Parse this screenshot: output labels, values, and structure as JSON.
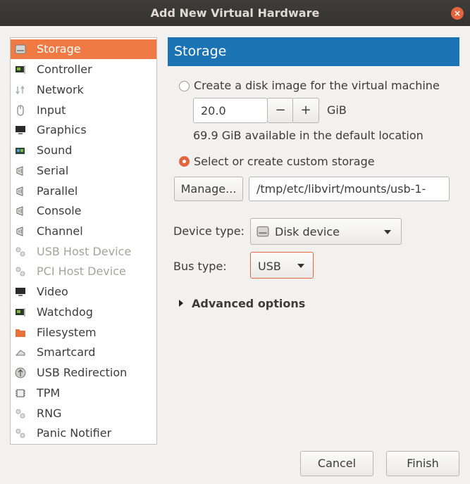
{
  "window": {
    "title": "Add New Virtual Hardware",
    "close_symbol": "×"
  },
  "sidebar": {
    "selected_index": 0,
    "items": [
      {
        "label": "Storage",
        "icon": "disk-icon",
        "enabled": true
      },
      {
        "label": "Controller",
        "icon": "chip-icon",
        "enabled": true
      },
      {
        "label": "Network",
        "icon": "network-icon",
        "enabled": true
      },
      {
        "label": "Input",
        "icon": "mouse-icon",
        "enabled": true
      },
      {
        "label": "Graphics",
        "icon": "monitor-icon",
        "enabled": true
      },
      {
        "label": "Sound",
        "icon": "sound-card-icon",
        "enabled": true
      },
      {
        "label": "Serial",
        "icon": "port-icon",
        "enabled": true
      },
      {
        "label": "Parallel",
        "icon": "port-icon",
        "enabled": true
      },
      {
        "label": "Console",
        "icon": "port-icon",
        "enabled": true
      },
      {
        "label": "Channel",
        "icon": "port-icon",
        "enabled": true
      },
      {
        "label": "USB Host Device",
        "icon": "device-icon",
        "enabled": false
      },
      {
        "label": "PCI Host Device",
        "icon": "device-icon",
        "enabled": false
      },
      {
        "label": "Video",
        "icon": "monitor-icon",
        "enabled": true
      },
      {
        "label": "Watchdog",
        "icon": "chip-icon",
        "enabled": true
      },
      {
        "label": "Filesystem",
        "icon": "folder-icon",
        "enabled": true
      },
      {
        "label": "Smartcard",
        "icon": "smartcard-icon",
        "enabled": true
      },
      {
        "label": "USB Redirection",
        "icon": "usb-icon",
        "enabled": true
      },
      {
        "label": "TPM",
        "icon": "tpm-chip-icon",
        "enabled": true
      },
      {
        "label": "RNG",
        "icon": "device-icon",
        "enabled": true
      },
      {
        "label": "Panic Notifier",
        "icon": "device-icon",
        "enabled": true
      }
    ]
  },
  "main": {
    "header": "Storage",
    "create_option": {
      "label": "Create a disk image for the virtual machine",
      "selected": false,
      "size_value": "20.0",
      "unit": "GiB",
      "minus": "−",
      "plus": "+",
      "available_text": "69.9 GiB available in the default location"
    },
    "custom_option": {
      "label": "Select or create custom storage",
      "selected": true,
      "manage_label": "Manage...",
      "path_value": "/tmp/etc/libvirt/mounts/usb-1-"
    },
    "device_type": {
      "label": "Device type:",
      "value": "Disk device",
      "icon": "disk-icon"
    },
    "bus_type": {
      "label": "Bus type:",
      "value": "USB"
    },
    "advanced": {
      "label": "Advanced options",
      "expanded": false
    }
  },
  "footer": {
    "cancel_label": "Cancel",
    "finish_label": "Finish"
  },
  "colors": {
    "accent": "#ef7a44",
    "header": "#1b73b4",
    "titlebar": "#3a3935",
    "close": "#e4643b"
  }
}
